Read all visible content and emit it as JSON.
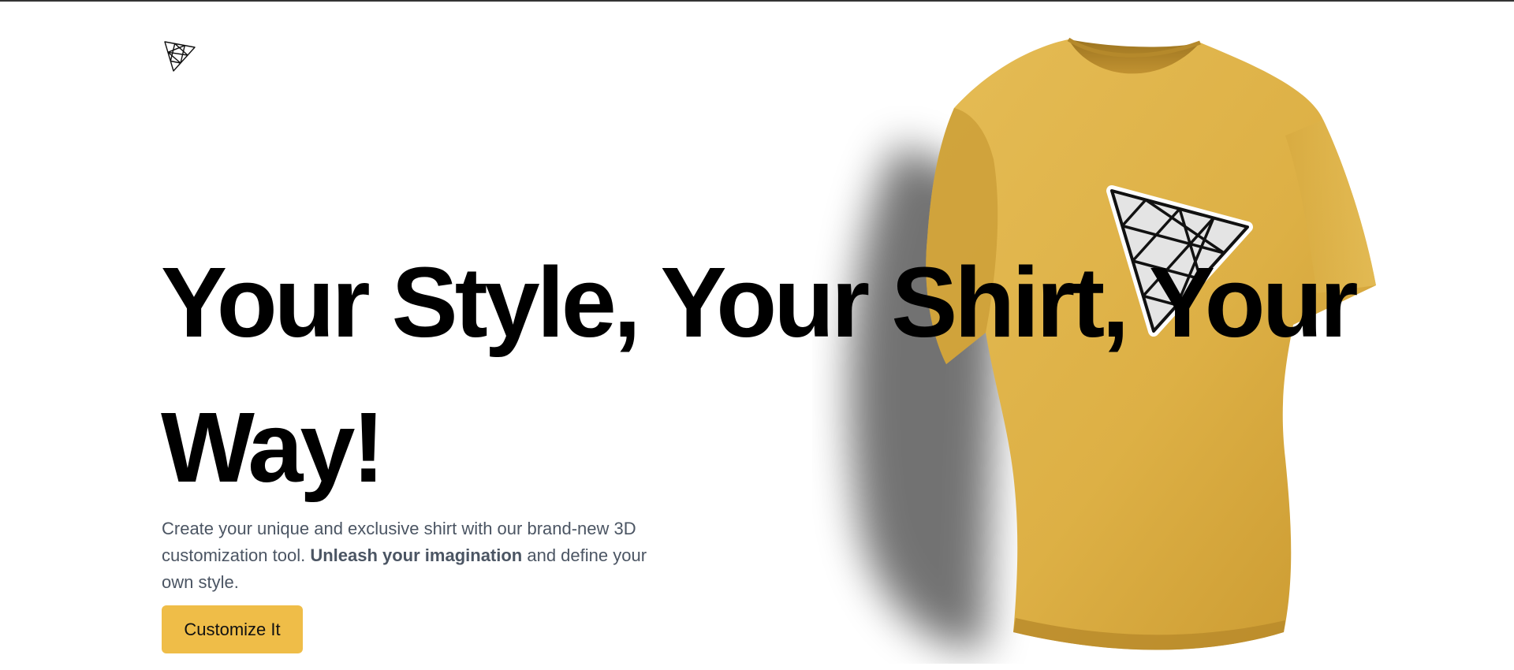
{
  "logo": {
    "icon": "triangle-grid-logo-icon"
  },
  "hero": {
    "headline": "Your Style, Your Shirt, Your Way!",
    "description": {
      "part1": "Create your unique and exclusive shirt with our brand-new 3D customization tool. ",
      "emphasis": "Unleash your imagination",
      "part2": " and define your own style."
    },
    "cta_label": "Customize It"
  },
  "shirt": {
    "icon": "tshirt-illustration",
    "decal_icon": "triangle-grid-decal-icon",
    "color": "#e0b447"
  },
  "colors": {
    "accent": "#efbd48",
    "text": "#000000",
    "muted_text": "#4b5563"
  }
}
